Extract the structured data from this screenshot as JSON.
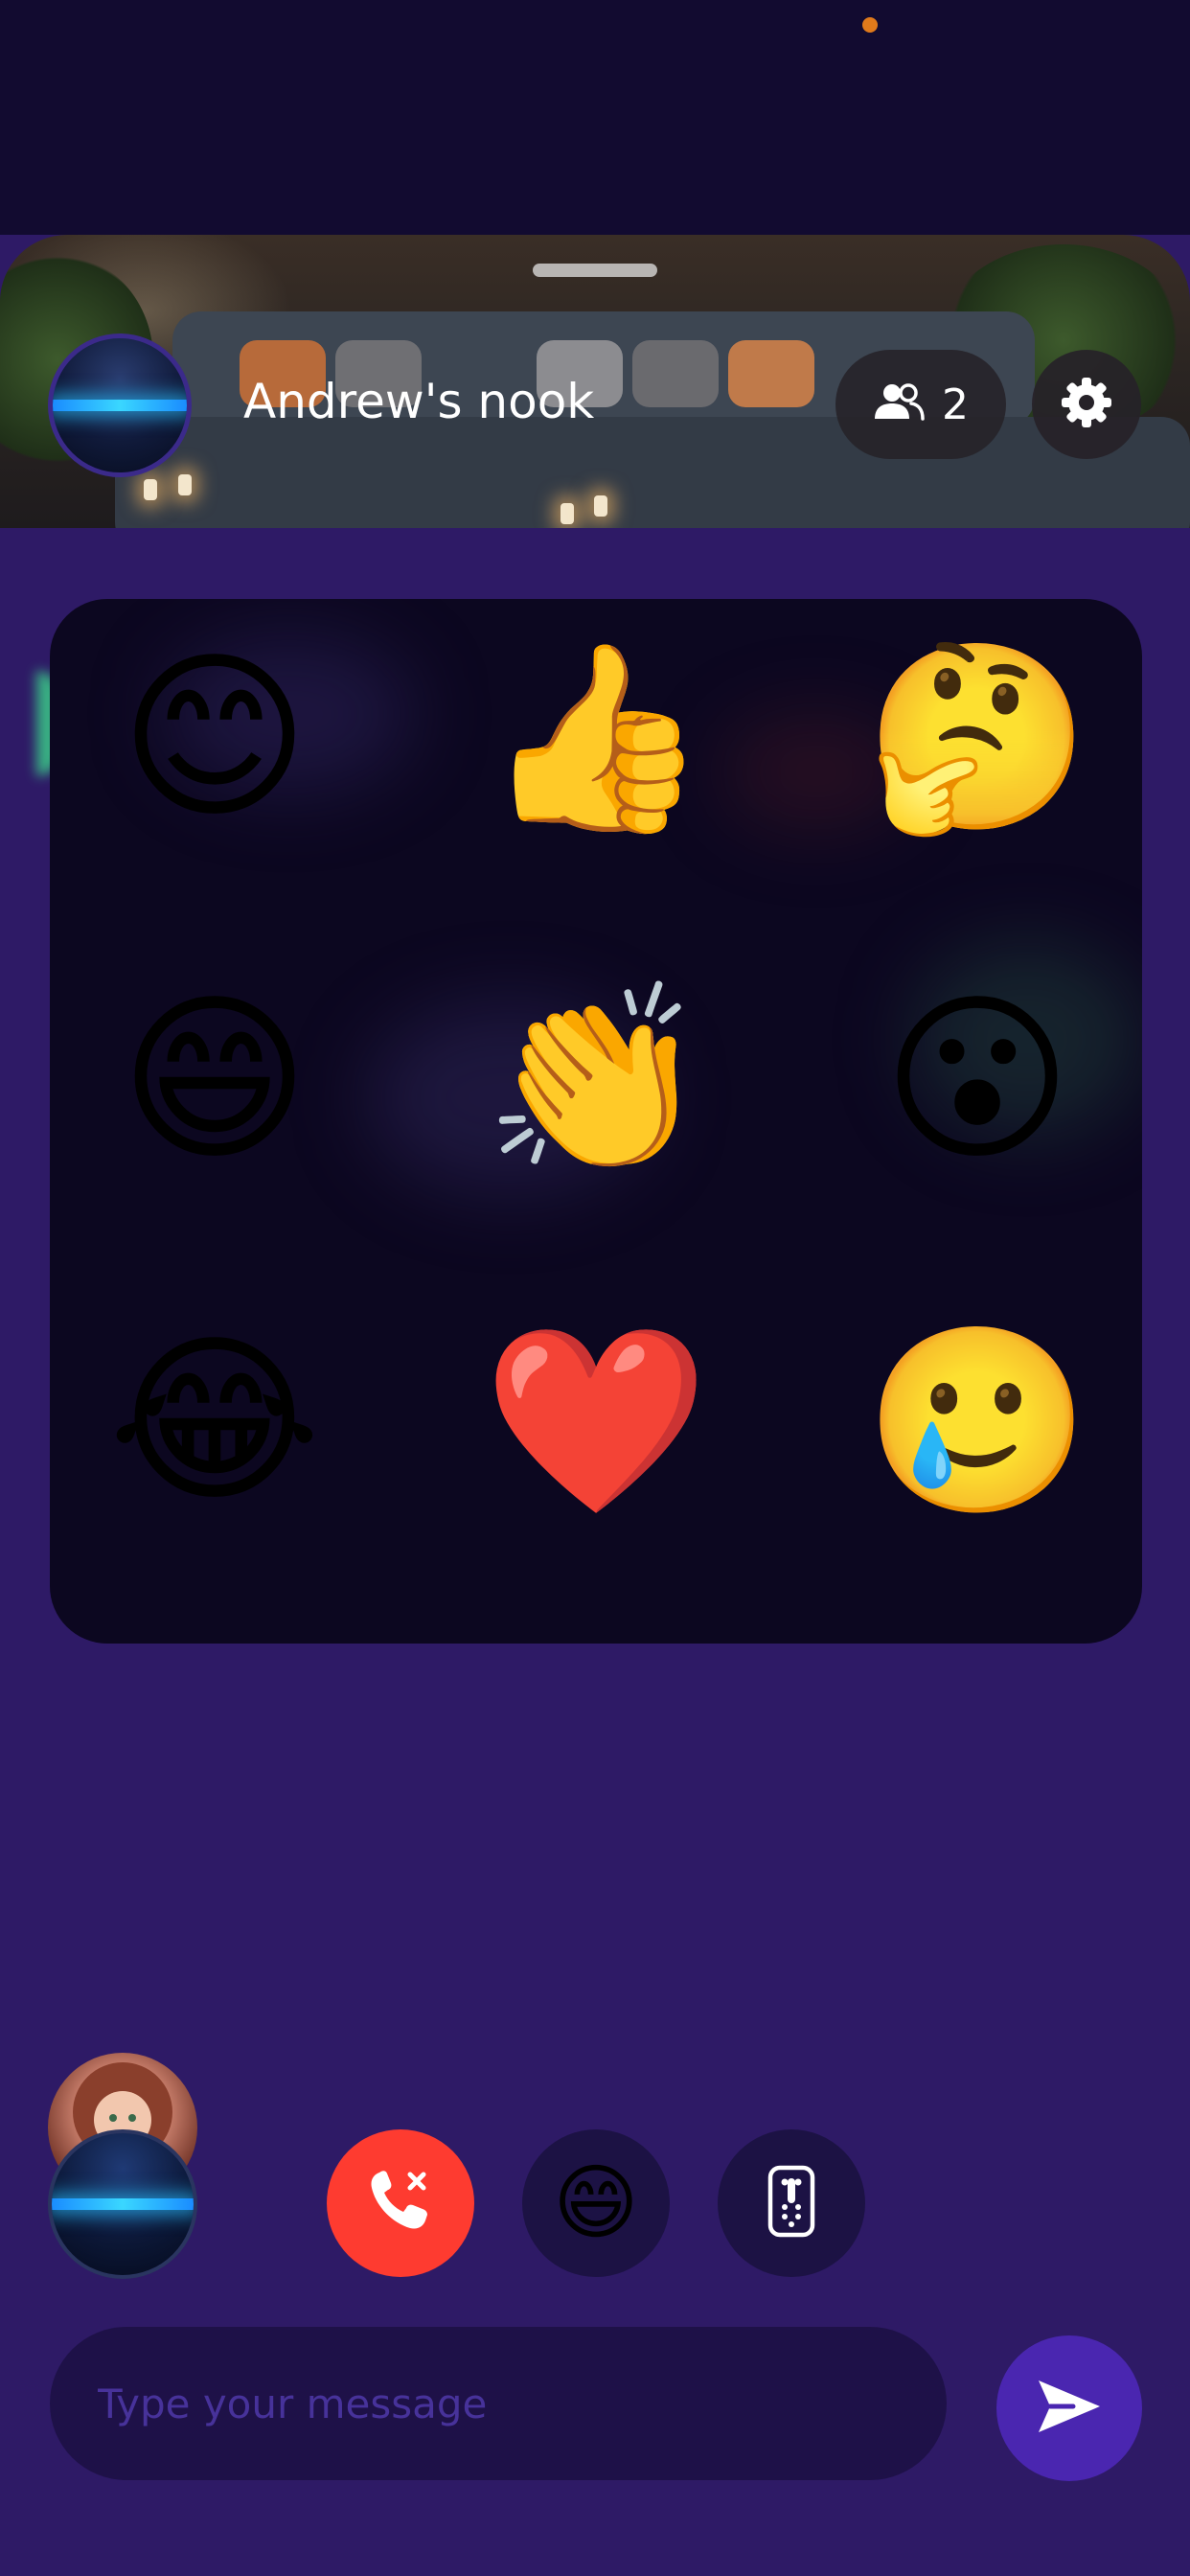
{
  "room": {
    "title": "Andrew's nook",
    "participant_count": "2"
  },
  "reactions": [
    {
      "name": "smiling-face-with-smiling-eyes",
      "glyph": "😊"
    },
    {
      "name": "thumbs-up",
      "glyph": "👍"
    },
    {
      "name": "thinking-face",
      "glyph": "🤔"
    },
    {
      "name": "grinning-face-with-smiling-eyes",
      "glyph": "😄"
    },
    {
      "name": "clapping-hands",
      "glyph": "👏"
    },
    {
      "name": "face-with-open-mouth",
      "glyph": "😮"
    },
    {
      "name": "face-with-tears-of-joy",
      "glyph": "😂"
    },
    {
      "name": "red-heart",
      "glyph": "❤️"
    },
    {
      "name": "face-holding-back-tears",
      "glyph": "🥲"
    }
  ],
  "controls": {
    "emoji_glyph": "😄"
  },
  "message": {
    "placeholder": "Type your message",
    "value": ""
  },
  "icons": {
    "participants": "people-icon",
    "settings": "gear-icon",
    "end_call": "phone-hangup-icon",
    "emoji": "emoji-icon",
    "remote": "remote-control-icon",
    "send": "send-icon"
  },
  "colors": {
    "background": "#2e1a66",
    "panel": "#0c0720",
    "end_call": "#fe3b30",
    "control_button": "#1c1244",
    "send_button": "#4a26b0",
    "placeholder": "#47329a",
    "avatar_glow": "#3ad7ff"
  }
}
